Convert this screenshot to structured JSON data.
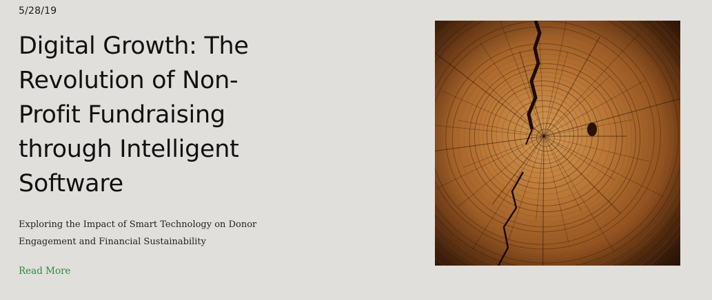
{
  "post": {
    "date": "5/28/19",
    "title": "Digital Growth: The Revolution of Non-Profit Fundraising through Intelligent Software",
    "subtitle": "Exploring the Impact of Smart Technology on Donor Engagement and Financial Sustainability",
    "read_more_label": "Read More",
    "image": {
      "subject": "tree-rings-cross-section",
      "colors": {
        "light": "#c8894a",
        "mid": "#9a5a26",
        "dark": "#4a230b",
        "crack": "#1d0c03"
      }
    }
  },
  "colors": {
    "background": "#e1dfdb",
    "text": "#111111",
    "link": "#2e8b3b"
  }
}
